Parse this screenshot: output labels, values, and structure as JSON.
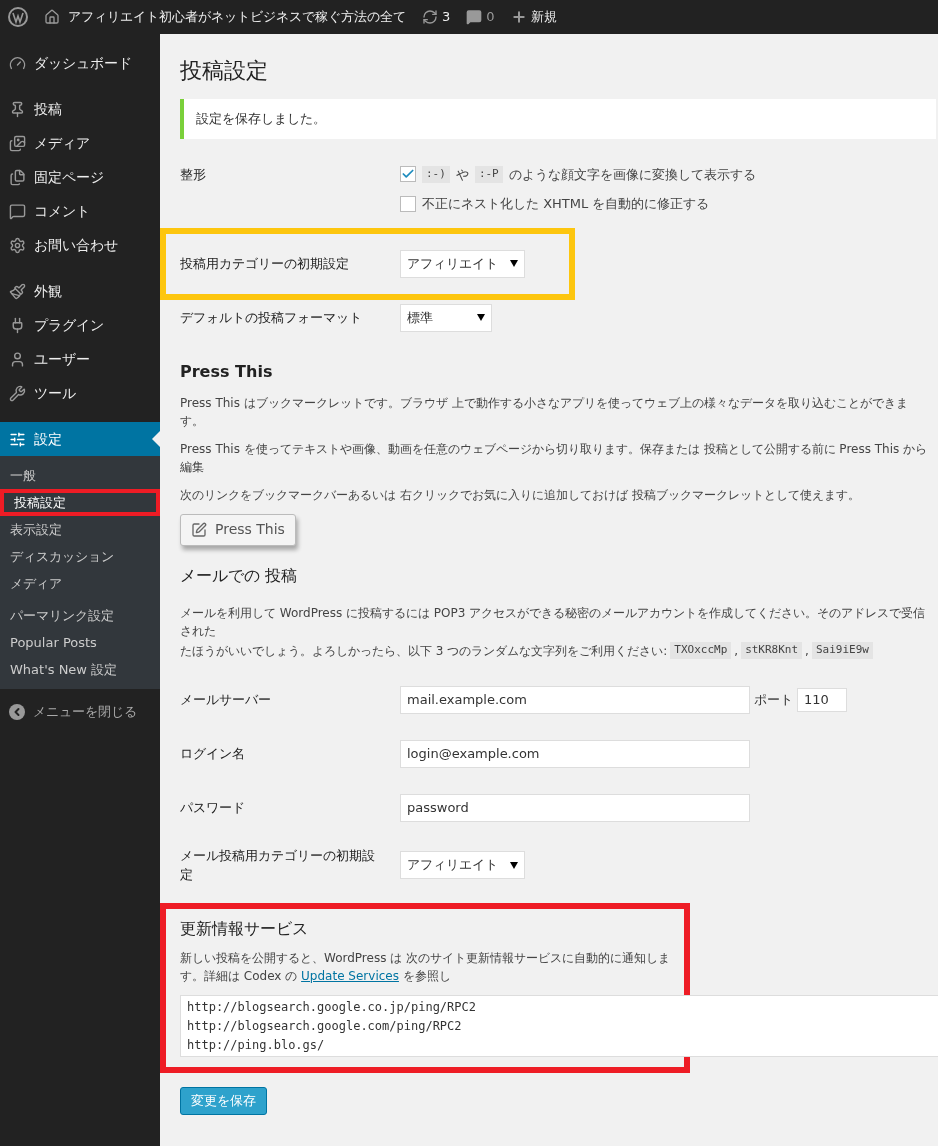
{
  "admin_bar": {
    "site_title": "アフィリエイト初心者がネットビジネスで稼ぐ方法の全て",
    "updates": "3",
    "comments": "0",
    "new": "新規"
  },
  "sidebar": {
    "items": [
      {
        "label": "ダッシュボード",
        "selected": false
      },
      {
        "label": "投稿",
        "selected": false
      },
      {
        "label": "メディア",
        "selected": false
      },
      {
        "label": "固定ページ",
        "selected": false
      },
      {
        "label": "コメント",
        "selected": false
      },
      {
        "label": "お問い合わせ",
        "selected": false
      },
      {
        "label": "外観",
        "selected": false
      },
      {
        "label": "プラグイン",
        "selected": false
      },
      {
        "label": "ユーザー",
        "selected": false
      },
      {
        "label": "ツール",
        "selected": false
      },
      {
        "label": "設定",
        "selected": true
      }
    ],
    "submenu": [
      {
        "label": "一般",
        "selected": false,
        "highlighted": false
      },
      {
        "label": "投稿設定",
        "selected": true,
        "highlighted": true
      },
      {
        "label": "表示設定",
        "selected": false,
        "highlighted": false
      },
      {
        "label": "ディスカッション",
        "selected": false,
        "highlighted": false
      },
      {
        "label": "メディア",
        "selected": false,
        "highlighted": false
      },
      {
        "label": "パーマリンク設定",
        "selected": false,
        "highlighted": false
      },
      {
        "label": "Popular Posts",
        "selected": false,
        "highlighted": false
      },
      {
        "label": "What's New 設定",
        "selected": false,
        "highlighted": false
      }
    ],
    "collapse": "メニューを閉じる"
  },
  "page": {
    "title": "投稿設定",
    "notice": "設定を保存しました。",
    "formatting": {
      "label": "整形",
      "options": [
        {
          "parts": [
            {
              "kind": "code",
              "text": ":-)"
            },
            {
              "kind": "text",
              "text": "や"
            },
            {
              "kind": "code",
              "text": ":-P"
            },
            {
              "kind": "text",
              "text": "のような顔文字を画像に変換して表示する"
            }
          ],
          "checked": true
        },
        {
          "parts": [
            {
              "kind": "text",
              "text": "不正にネスト化した XHTML を自動的に修正する"
            }
          ],
          "checked": false
        }
      ]
    },
    "selects": [
      {
        "label": "投稿用カテゴリーの初期設定",
        "value": "アフィリエイト",
        "highlighted": true
      },
      {
        "label": "デフォルトの投稿フォーマット",
        "value": "標準",
        "highlighted": false
      }
    ],
    "press_this": {
      "heading": "Press This",
      "paragraphs": [
        "Press This はブックマークレットです。ブラウザ 上で動作する小さなアプリを使ってウェブ上の様々なデータを取り込むことができます。",
        "Press This を使ってテキストや画像、動画を任意のウェブページから切り取ります。保存または 投稿として公開する前に Press This から編集",
        "次のリンクをブックマークバーあるいは 右クリックでお気に入りに追加しておけば 投稿ブックマークレットとして使えます。"
      ],
      "button": "Press This"
    },
    "post_via_email": {
      "heading": "メールでの 投稿",
      "line_1": "メールを利用して WordPress に投稿するには POP3 アクセスができる秘密のメールアカウントを作成してください。そのアドレスで受信された",
      "line_2": "たほうがいいでしょう。よろしかったら、以下 3 つのランダムな文字列をご利用ください:",
      "codes": [
        "TXOxccMp",
        "stKR8Knt",
        "Sai9iE9w"
      ],
      "separator": ",",
      "mail_server": {
        "label": "メールサーバー",
        "value": "mail.example.com",
        "port_label": "ポート",
        "port": "110"
      },
      "login": {
        "label": "ログイン名",
        "value": "login@example.com"
      },
      "password": {
        "label": "パスワード",
        "value": "password"
      },
      "category": {
        "label": "メール投稿用カテゴリーの初期設定",
        "value": "アフィリエイト"
      }
    },
    "update_services": {
      "heading": "更新情報サービス",
      "description_before": "新しい投稿を公開すると、WordPress は 次のサイト更新情報サービスに自動的に通知します。詳細は Codex の",
      "link": "Update Services",
      "description_after": "を参照し",
      "urls": [
        "http://blogsearch.google.co.jp/ping/RPC2",
        "http://blogsearch.google.com/ping/RPC2",
        "http://ping.blo.gs/"
      ],
      "highlighted": true
    },
    "save_button": "変更を保存"
  }
}
